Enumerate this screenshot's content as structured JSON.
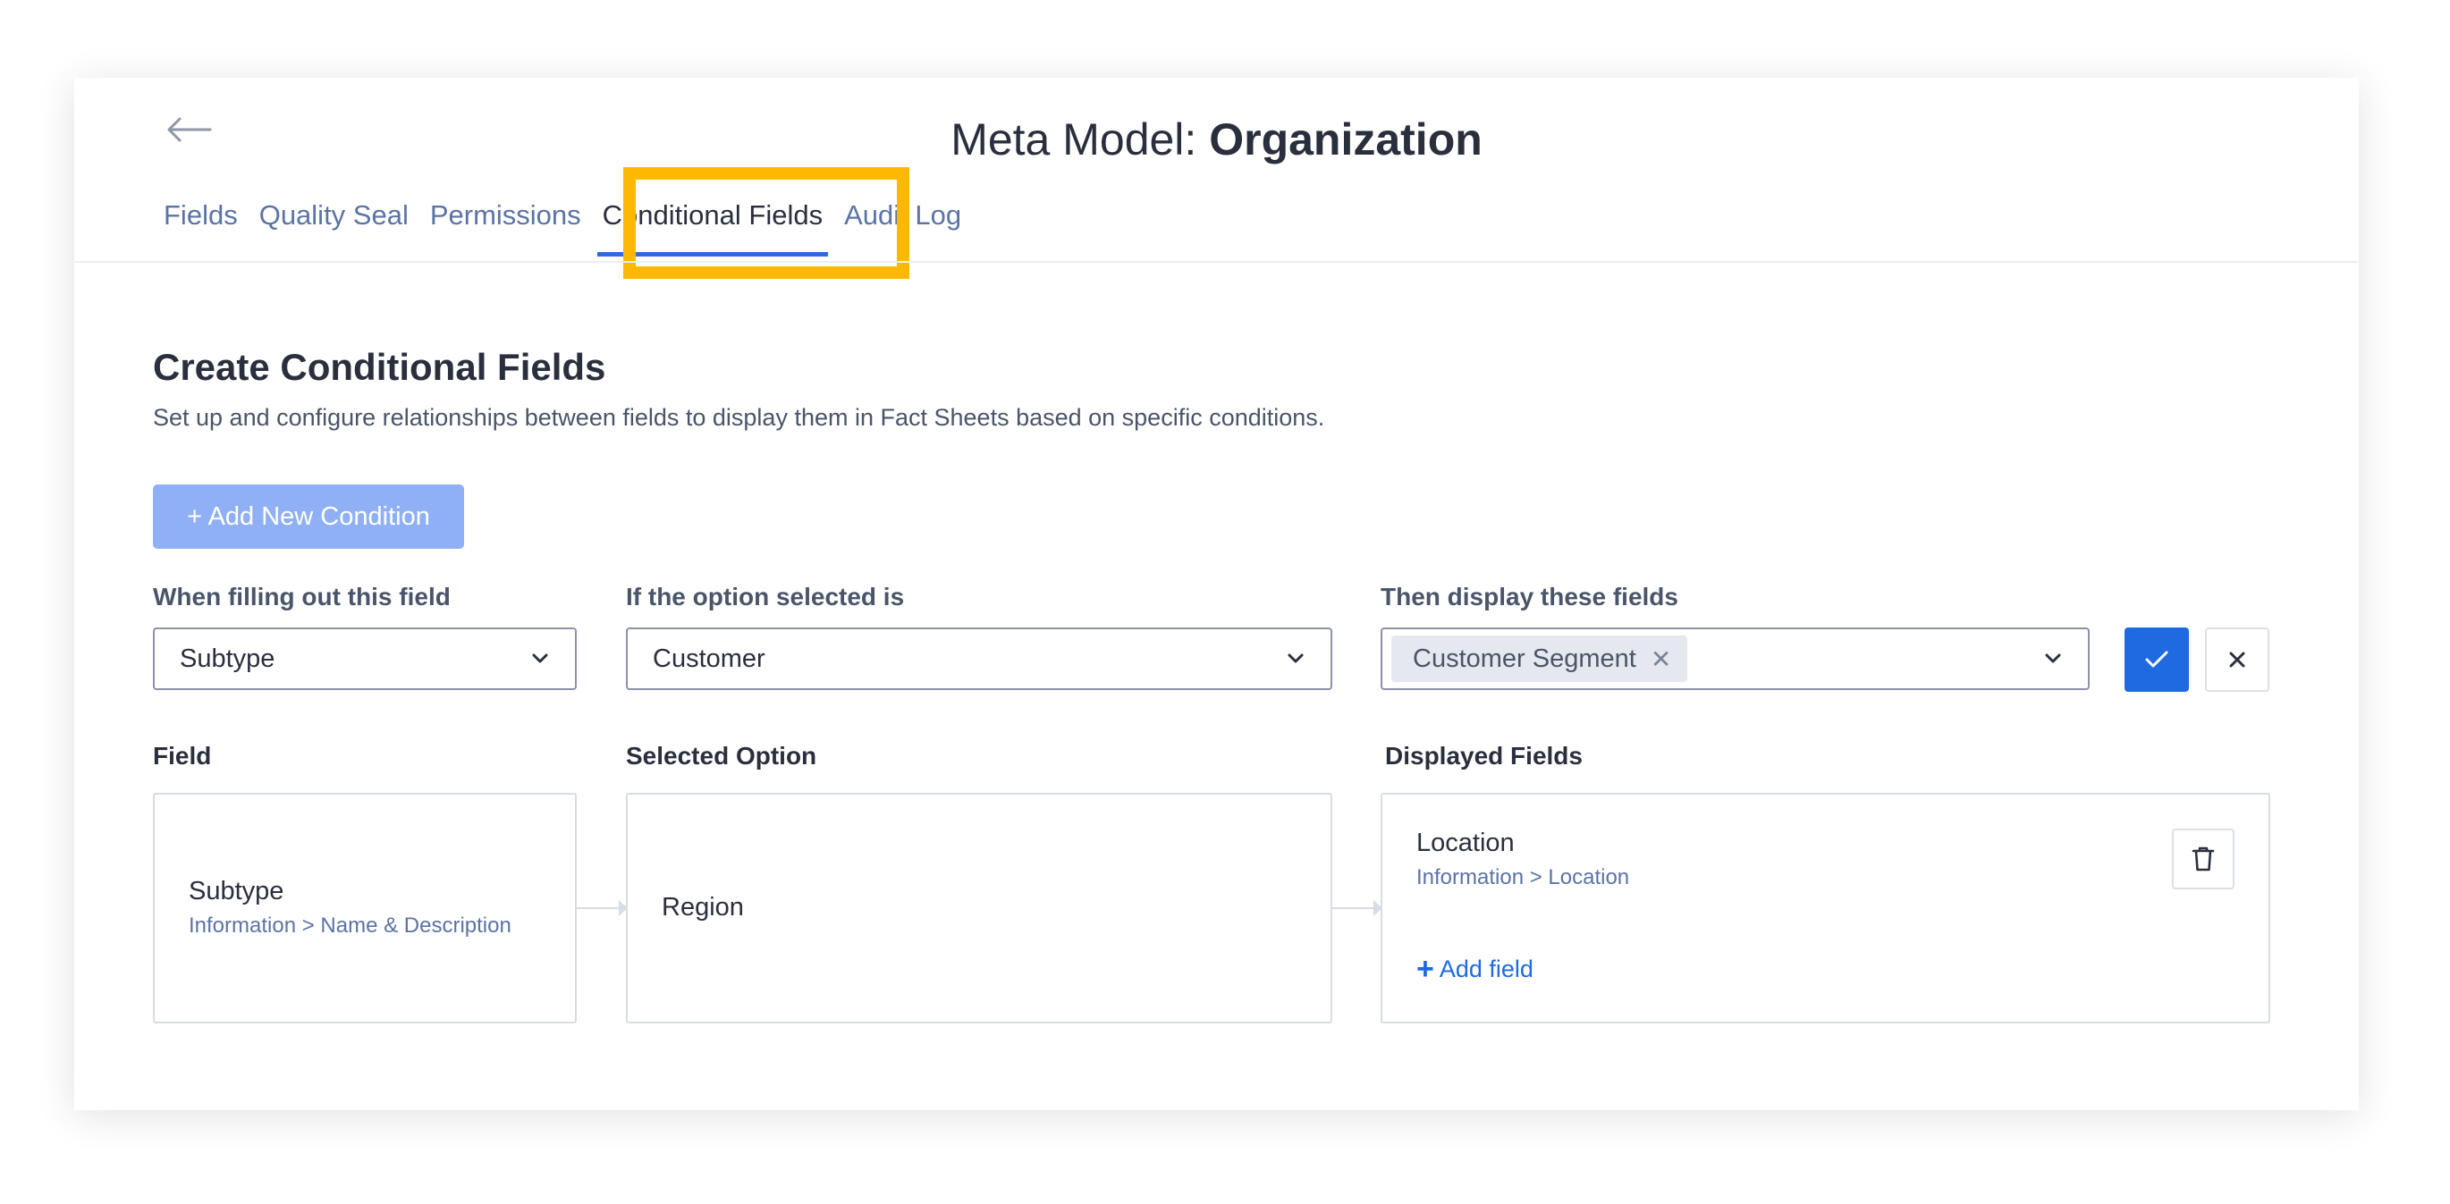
{
  "header": {
    "title_prefix": "Meta Model:",
    "title_entity": "Organization"
  },
  "tabs": [
    {
      "label": "Fields"
    },
    {
      "label": "Quality Seal"
    },
    {
      "label": "Permissions"
    },
    {
      "label": "Conditional Fields",
      "active": true
    },
    {
      "label": "Audit Log"
    }
  ],
  "section": {
    "heading": "Create Conditional Fields",
    "description": "Set up and configure relationships between fields to display them in Fact Sheets based on specific conditions.",
    "add_condition_label": "+ Add New Condition"
  },
  "form": {
    "field_label": "When filling out this field",
    "field_value": "Subtype",
    "option_label": "If the option selected is",
    "option_value": "Customer",
    "display_label": "Then display these fields",
    "display_chips": [
      "Customer Segment"
    ],
    "chip_remove": "✕"
  },
  "condition": {
    "field_header": "Field",
    "option_header": "Selected Option",
    "displayed_header": "Displayed Fields",
    "field_name": "Subtype",
    "field_path": "Information > Name & Description",
    "option_value": "Region",
    "displayed_name": "Location",
    "displayed_path": "Information > Location",
    "add_field_plus": "+",
    "add_field_label": "Add field"
  },
  "colors": {
    "accent": "#1f6ae0",
    "highlight": "#fcb900",
    "tab_link": "#5b73a5",
    "button_disabled": "#8fb0f4"
  },
  "icons": {
    "back": "arrow-left-icon",
    "dropdown": "chevron-down-icon",
    "confirm": "check-icon",
    "cancel": "close-icon",
    "delete": "trash-icon"
  }
}
